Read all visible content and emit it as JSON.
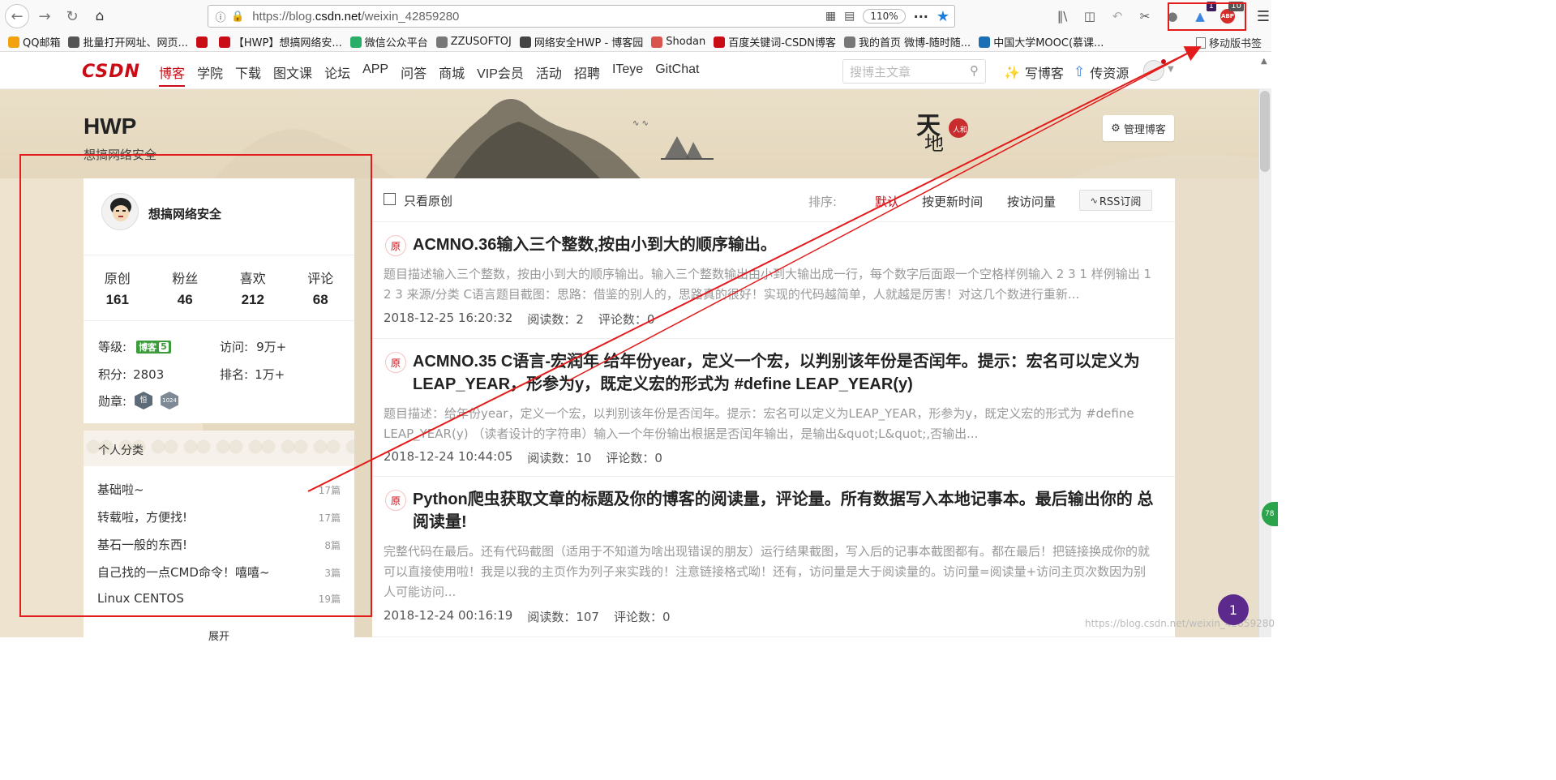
{
  "browser": {
    "url_prefix": "https://blog.",
    "url_domain": "csdn.net",
    "url_path": "/weixin_42859280",
    "zoom": "110%",
    "badge_1": "1",
    "badge_2": "10",
    "bookmarks": [
      {
        "label": "QQ邮箱",
        "color": "#f2a20c"
      },
      {
        "label": "批量打开网址、网页...",
        "color": "#555555"
      },
      {
        "label": "",
        "color": "#ca0c16"
      },
      {
        "label": "【HWP】想搞网络安...",
        "color": "#ca0c16"
      },
      {
        "label": "微信公众平台",
        "color": "#2aae67"
      },
      {
        "label": "ZZUSOFTOJ",
        "color": "#777777"
      },
      {
        "label": "网络安全HWP - 博客园",
        "color": "#444444"
      },
      {
        "label": "Shodan",
        "color": "#d9534f"
      },
      {
        "label": "百度关键词-CSDN博客",
        "color": "#ca0c16"
      },
      {
        "label": "我的首页 微博-随时随...",
        "color": "#777777"
      },
      {
        "label": "中国大学MOOC(慕课...",
        "color": "#1c6fb5"
      }
    ],
    "mobile_bookmarks": "移动版书签"
  },
  "csdn": {
    "logo_a": "CS",
    "logo_b": "DN",
    "menu": [
      "博客",
      "学院",
      "下载",
      "图文课",
      "论坛",
      "APP",
      "问答",
      "商城",
      "VIP会员",
      "活动",
      "招聘",
      "ITeye",
      "GitChat"
    ],
    "search_placeholder": "搜博主文章",
    "write": "写博客",
    "upload": "传资源"
  },
  "blog": {
    "title": "HWP",
    "subtitle": "想搞网络安全",
    "manage": "管理博客"
  },
  "profile": {
    "name": "想搞网络安全",
    "stats": [
      {
        "label": "原创",
        "value": "161"
      },
      {
        "label": "粉丝",
        "value": "46"
      },
      {
        "label": "喜欢",
        "value": "212"
      },
      {
        "label": "评论",
        "value": "68"
      }
    ],
    "level_label": "等级:",
    "level_badge": "博客",
    "level_num": "5",
    "visit_label": "访问:",
    "visit_value": "9万+",
    "points_label": "积分:",
    "points_value": "2803",
    "rank_label": "排名:",
    "rank_value": "1万+",
    "medal_label": "勋章:",
    "medal_1": "恒",
    "medal_2": "1024"
  },
  "categories": {
    "heading": "个人分类",
    "items": [
      {
        "name": "基础啦~",
        "count": "17篇"
      },
      {
        "name": "转载啦，方便找!",
        "count": "17篇"
      },
      {
        "name": "基石一般的东西!",
        "count": "8篇"
      },
      {
        "name": "自己找的一点CMD命令！嘻嘻~",
        "count": "3篇"
      },
      {
        "name": "Linux CENTOS",
        "count": "19篇"
      }
    ],
    "expand": "展开"
  },
  "list": {
    "only_original": "只看原创",
    "sort_label": "排序:",
    "sort_default": "默认",
    "sort_updated": "按更新时间",
    "sort_visits": "按访问量",
    "rss": "RSS订阅",
    "articles": [
      {
        "tag": "原",
        "title": "ACMNO.36输入三个整数,按由小到大的顺序输出。",
        "desc": "题目描述输入三个整数，按由小到大的顺序输出。输入三个整数输出由小到大输出成一行，每个数字后面跟一个空格样例输入 2 3 1 样例输出 1 2 3 来源/分类 C语言题目截图：思路：借鉴的别人的，思路真的很好！实现的代码越简单，人就越是厉害！对这几个数进行重新...",
        "date": "2018-12-25 16:20:32",
        "reads": "阅读数：2",
        "comments": "评论数：0"
      },
      {
        "tag": "原",
        "title": "ACMNO.35 C语言-宏润年 给年份year，定义一个宏，以判别该年份是否闰年。提示：宏名可以定义为 LEAP_YEAR，形参为y，既定义宏的形式为 #define LEAP_YEAR(y)",
        "desc": "题目描述：给年份year，定义一个宏，以判别该年份是否闰年。提示：宏名可以定义为LEAP_YEAR，形参为y，既定义宏的形式为 #define LEAP_YEAR(y) （读者设计的字符串）输入一个年份输出根据是否闰年输出，是输出&quot;L&quot;,否输出...",
        "date": "2018-12-24 10:44:05",
        "reads": "阅读数：10",
        "comments": "评论数：0"
      },
      {
        "tag": "原",
        "title": "Python爬虫获取文章的标题及你的博客的阅读量，评论量。所有数据写入本地记事本。最后输出你的 总阅读量!",
        "desc": "完整代码在最后。还有代码截图（适用于不知道为啥出现错误的朋友）运行结果截图，写入后的记事本截图都有。都在最后！把链接换成你的就可以直接使用啦！我是以我的主页作为列子来实践的！注意链接格式呦！还有，访问量是大于阅读量的。访问量=阅读量+访问主页次数因为别人可能访问...",
        "date": "2018-12-24 00:16:19",
        "reads": "阅读数：107",
        "comments": "评论数：0"
      }
    ]
  },
  "overlay": {
    "watermark": "https://blog.csdn.net/weixin_42859280",
    "fab": "1",
    "side_badge": "78"
  },
  "colors": {
    "brand": "#ca0c16",
    "annotation": "#e21b1b"
  }
}
